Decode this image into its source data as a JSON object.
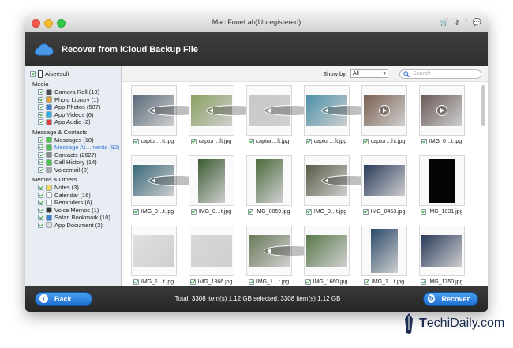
{
  "window": {
    "title": "Mac FoneLab(Unregistered)"
  },
  "title_icons": [
    "cart-icon",
    "key-icon",
    "facebook-icon",
    "chat-icon"
  ],
  "header": {
    "title": "Recover from iCloud Backup File"
  },
  "sidebar": {
    "root": "Aiseesoft",
    "groups": [
      {
        "label": "Media",
        "items": [
          {
            "label": "Camera Roll (13)",
            "icon": "camera-roll-icon",
            "color": "#4a4a4a"
          },
          {
            "label": "Photo Library (1)",
            "icon": "photo-library-icon",
            "color": "#e8a030"
          },
          {
            "label": "App Photos (507)",
            "icon": "app-photos-icon",
            "color": "#3b7fd8"
          },
          {
            "label": "App Videos (6)",
            "icon": "app-videos-icon",
            "color": "#2ab0e8"
          },
          {
            "label": "App Audio (2)",
            "icon": "app-audio-icon",
            "color": "#e04040"
          }
        ]
      },
      {
        "label": "Message & Contacts",
        "items": [
          {
            "label": "Messages (18)",
            "icon": "messages-icon",
            "color": "#4cc34c"
          },
          {
            "label": "Message At…ments (82)",
            "icon": "message-attachments-icon",
            "color": "#4cc34c",
            "selected": true
          },
          {
            "label": "Contacts (2627)",
            "icon": "contacts-icon",
            "color": "#8a8a8a"
          },
          {
            "label": "Call History (14)",
            "icon": "call-history-icon",
            "color": "#4cc34c"
          },
          {
            "label": "Voicemail (0)",
            "icon": "voicemail-icon",
            "color": "#aaaaaa"
          }
        ]
      },
      {
        "label": "Memos & Others",
        "items": [
          {
            "label": "Notes (3)",
            "icon": "notes-icon",
            "color": "#f5d65a"
          },
          {
            "label": "Calendar (16)",
            "icon": "calendar-icon",
            "color": "#ffffff"
          },
          {
            "label": "Reminders (6)",
            "icon": "reminders-icon",
            "color": "#ffffff"
          },
          {
            "label": "Voice Memos (1)",
            "icon": "voice-memos-icon",
            "color": "#333333"
          },
          {
            "label": "Safari Bookmark (10)",
            "icon": "safari-icon",
            "color": "#3b7fd8"
          },
          {
            "label": "App Document (2)",
            "icon": "app-document-icon",
            "color": "#dddddd"
          }
        ]
      }
    ]
  },
  "toolbar": {
    "show_by_label": "Show by:",
    "show_by_value": "All",
    "search_placeholder": "Search"
  },
  "files": [
    {
      "name": "captur…ft.jpg",
      "video": true,
      "tone": "#5a6a7a"
    },
    {
      "name": "captur…ft.jpg",
      "video": true,
      "tone": "#8aa060"
    },
    {
      "name": "captur…ft.jpg",
      "video": true,
      "tone": "#c8c8c8"
    },
    {
      "name": "captur…ft.jpg",
      "video": true,
      "tone": "#4a90a8"
    },
    {
      "name": "captur…ht.jpg",
      "video": true,
      "tone": "#7a6050"
    },
    {
      "name": "IMG_0…t.jpg",
      "video": true,
      "tone": "#6a5a58"
    },
    {
      "name": "IMG_0…t.jpg",
      "video": true,
      "tone": "#3a6a7a"
    },
    {
      "name": "IMG_0…t.jpg",
      "video": false,
      "tone": "#3a5a30",
      "tall": true
    },
    {
      "name": "IMG_0059.jpg",
      "video": false,
      "tone": "#4a6a3a",
      "tall": true
    },
    {
      "name": "IMG_0…t.jpg",
      "video": true,
      "tone": "#5a5a48"
    },
    {
      "name": "IMG_0453.jpg",
      "video": false,
      "tone": "#2a3a5a"
    },
    {
      "name": "IMG_1031.jpg",
      "video": false,
      "tone": "#050505",
      "tall": true
    },
    {
      "name": "IMG_1…t.jpg",
      "video": false,
      "tone": "#e0e0e0"
    },
    {
      "name": "IMG_1366.jpg",
      "video": false,
      "tone": "#d8d8d8"
    },
    {
      "name": "IMG_1…t.jpg",
      "video": true,
      "tone": "#6a7a5a"
    },
    {
      "name": "IMG_1660.jpg",
      "video": false,
      "tone": "#5a7a4a"
    },
    {
      "name": "IMG_1…t.jpg",
      "video": false,
      "tone": "#2a4a6a",
      "tall": true
    },
    {
      "name": "IMG_1750.jpg",
      "video": false,
      "tone": "#2a3a5a"
    }
  ],
  "footer": {
    "back_label": "Back",
    "total_text": "Total: 3308 item(s) 1.12 GB   selected: 3308 item(s) 1.12 GB",
    "recover_label": "Recover"
  },
  "watermark": {
    "brand_first": "T",
    "brand_rest": "echiDaily.com"
  },
  "colors": {
    "accent": "#2a7fe0",
    "header_bg": "#333333",
    "check": "#27a12e"
  }
}
